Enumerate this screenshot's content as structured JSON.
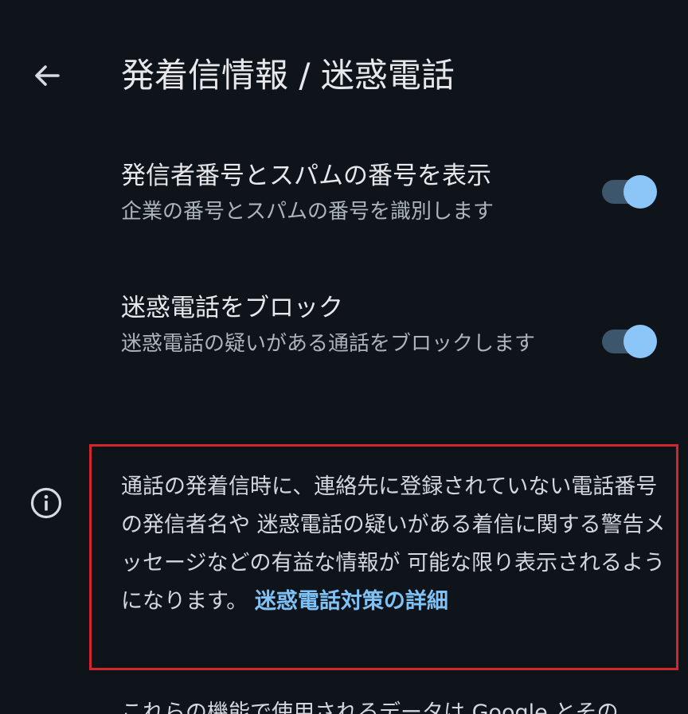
{
  "header": {
    "back_icon": "arrow-left-icon",
    "title": "発着信情報 / 迷惑電話"
  },
  "settings": [
    {
      "title": "発信者番号とスパムの番号を表示",
      "subtitle": "企業の番号とスパムの番号を識別します",
      "enabled": true
    },
    {
      "title": "迷惑電話をブロック",
      "subtitle": "迷惑電話の疑いがある通話をブロックします",
      "enabled": true
    }
  ],
  "info": {
    "icon": "info-icon",
    "text": "通話の発着信時に、連絡先に登録されていない電話番号の発信者名や 迷惑電話の疑いがある着信に関する警告メッセージなどの有益な情報が 可能な限り表示されるようになります。",
    "link": "迷惑電話対策の詳細"
  },
  "footer": {
    "text": "これらの機能で使用されるデータは Google とその"
  },
  "colors": {
    "background": "#0f141a",
    "accent": "#8cc6f9",
    "highlight_border": "#d3252b"
  }
}
